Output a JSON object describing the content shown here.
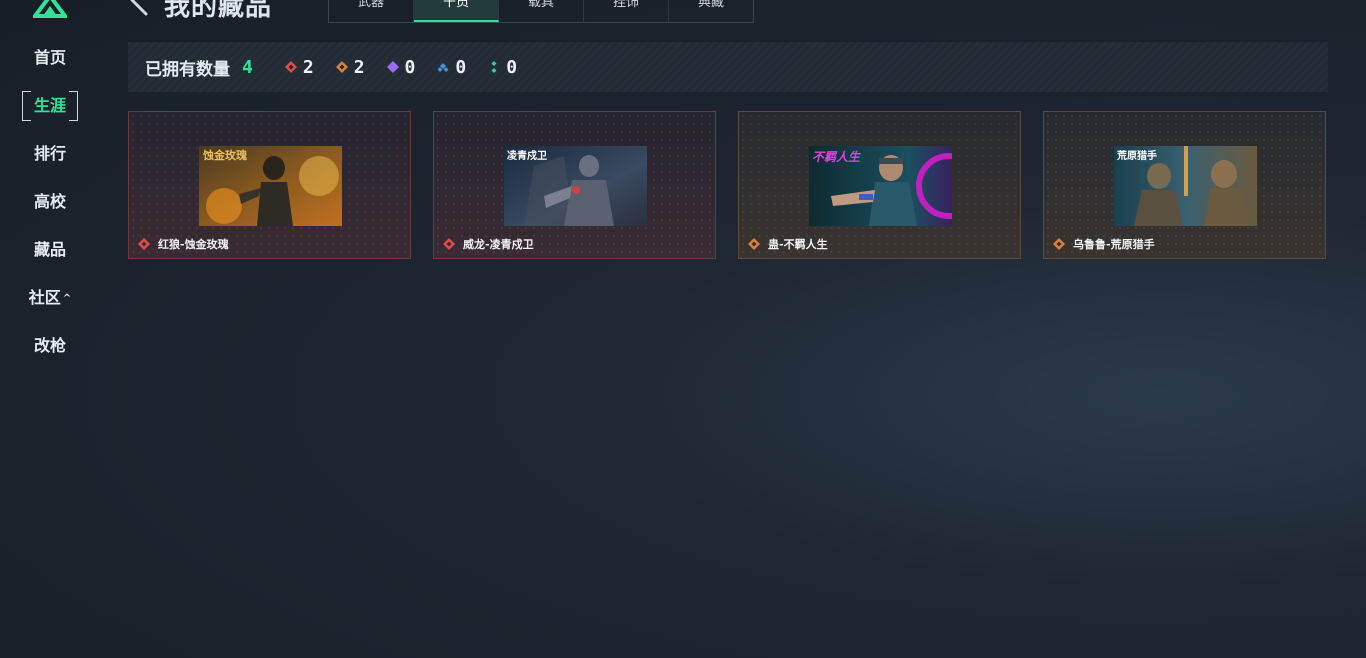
{
  "nav": {
    "items": [
      {
        "label": "首页"
      },
      {
        "label": "生涯"
      },
      {
        "label": "排行"
      },
      {
        "label": "高校"
      },
      {
        "label": "藏品"
      },
      {
        "label": "社区"
      },
      {
        "label": "改枪"
      }
    ],
    "active_index": 1,
    "community_caret": "^"
  },
  "header": {
    "title": "我的藏品",
    "tabs": [
      {
        "label": "武器"
      },
      {
        "label": "干员"
      },
      {
        "label": "载具"
      },
      {
        "label": "挂饰"
      },
      {
        "label": "典藏"
      }
    ],
    "active_tab": 1
  },
  "stats": {
    "owned_label": "已拥有数量",
    "owned_count": "4",
    "rarities": [
      {
        "color": "#e04b4b",
        "value": "2",
        "icon": "red-diamond-icon"
      },
      {
        "color": "#d9803f",
        "value": "2",
        "icon": "orange-diamond-icon"
      },
      {
        "color": "#9b6cf0",
        "value": "0",
        "icon": "purple-diamond-icon"
      },
      {
        "color": "#4d8fe0",
        "value": "0",
        "icon": "blue-diamond-icon"
      },
      {
        "color": "#2fd39a",
        "value": "0",
        "icon": "green-diamond-icon"
      }
    ]
  },
  "cards": [
    {
      "name": "红狼-蚀金玫瑰",
      "rarity_color": "#e04b4b",
      "image_caption": "蚀金玫瑰"
    },
    {
      "name": "威龙-凌青戍卫",
      "rarity_color": "#e04b4b",
      "image_caption": "凌青戍卫"
    },
    {
      "name": "蛊-不羁人生",
      "rarity_color": "#d9803f",
      "image_caption": "不羁人生"
    },
    {
      "name": "乌鲁鲁-荒原猎手",
      "rarity_color": "#d9803f",
      "image_caption": "荒原猎手"
    }
  ],
  "colors": {
    "accent": "#2fe39a"
  }
}
